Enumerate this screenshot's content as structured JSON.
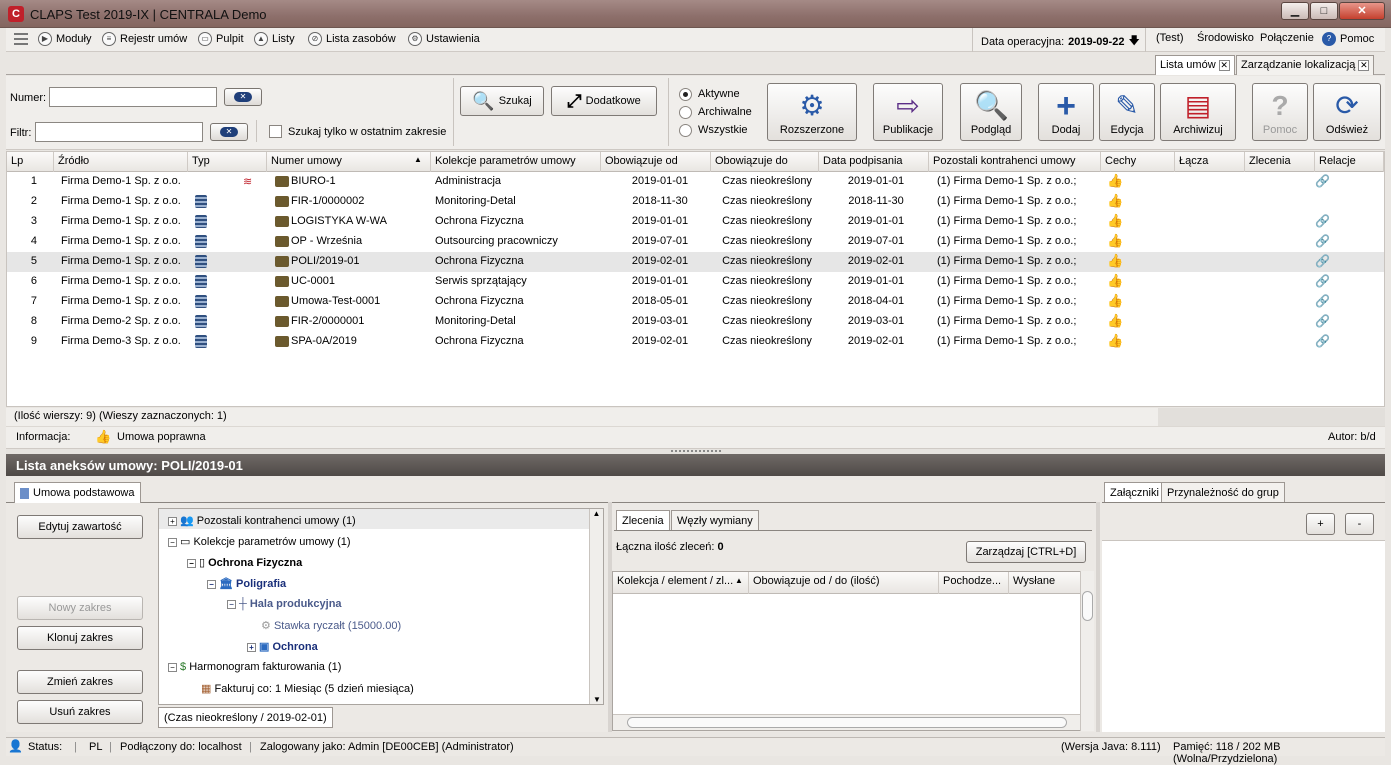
{
  "window": {
    "title": "CLAPS Test 2019-IX | CENTRALA Demo",
    "minimize": "▁",
    "maximize": "□",
    "close": "✕"
  },
  "menu": {
    "items": [
      {
        "label": "Moduły",
        "icon": "modules-icon"
      },
      {
        "label": "Rejestr umów",
        "icon": "register-icon"
      },
      {
        "label": "Pulpit",
        "icon": "desktop-icon"
      },
      {
        "label": "Listy",
        "icon": "lists-icon"
      },
      {
        "label": "Lista zasobów",
        "icon": "resources-icon"
      },
      {
        "label": "Ustawienia",
        "icon": "settings-icon"
      }
    ],
    "date_label": "Data operacyjna:",
    "date_value": "2019-09-22",
    "env_test": "(Test)",
    "env": "Środowisko",
    "connection": "Połączenie",
    "help": "Pomoc"
  },
  "tabs": [
    {
      "label": "Lista umów"
    },
    {
      "label": "Zarządzanie lokalizacją"
    }
  ],
  "toolbar": {
    "numer_label": "Numer:",
    "numer_value": "",
    "filtr_label": "Filtr:",
    "filtr_value": "",
    "only_last_label": "Szukaj tylko w ostatnim zakresie",
    "search_label": "Szukaj",
    "extra_label": "Dodatkowe",
    "radio": [
      "Aktywne",
      "Archiwalne",
      "Wszystkie"
    ],
    "radio_selected": "Aktywne",
    "buttons": {
      "extended": "Rozszerzone",
      "publication": "Publikacje",
      "preview": "Podgląd",
      "add": "Dodaj",
      "edit": "Edycja",
      "archive": "Archiwizuj",
      "help": "Pomoc",
      "refresh": "Odśwież"
    }
  },
  "table": {
    "columns": [
      "Lp",
      "Źródło",
      "Typ",
      "Numer umowy",
      "Kolekcje parametrów umowy",
      "Obowiązuje od",
      "Obowiązuje do",
      "Data podpisania",
      "Pozostali kontrahenci umowy",
      "Cechy",
      "Łącza",
      "Zlecenia",
      "Relacje"
    ],
    "rows": [
      {
        "lp": "1",
        "src": "Firma Demo-1 Sp. z o.o.",
        "num": "BIURO-1",
        "kol": "Administracja",
        "od": "2019-01-01",
        "do": "Czas nieokreślony",
        "podp": "2019-01-01",
        "kontr": "(1) Firma Demo-1 Sp. z o.o.;"
      },
      {
        "lp": "2",
        "src": "Firma Demo-1 Sp. z o.o.",
        "num": "FIR-1/0000002",
        "kol": "Monitoring-Detal",
        "od": "2018-11-30",
        "do": "Czas nieokreślony",
        "podp": "2018-11-30",
        "kontr": "(1) Firma Demo-1 Sp. z o.o.;"
      },
      {
        "lp": "3",
        "src": "Firma Demo-1 Sp. z o.o.",
        "num": "LOGISTYKA W-WA",
        "kol": "Ochrona Fizyczna",
        "od": "2019-01-01",
        "do": "Czas nieokreślony",
        "podp": "2019-01-01",
        "kontr": "(1) Firma Demo-1 Sp. z o.o.;"
      },
      {
        "lp": "4",
        "src": "Firma Demo-1 Sp. z o.o.",
        "num": "OP - Września",
        "kol": "Outsourcing pracowniczy",
        "od": "2019-07-01",
        "do": "Czas nieokreślony",
        "podp": "2019-07-01",
        "kontr": "(1) Firma Demo-1 Sp. z o.o.;"
      },
      {
        "lp": "5",
        "src": "Firma Demo-1 Sp. z o.o.",
        "num": "POLI/2019-01",
        "kol": "Ochrona Fizyczna",
        "od": "2019-02-01",
        "do": "Czas nieokreślony",
        "podp": "2019-02-01",
        "kontr": "(1) Firma Demo-1 Sp. z o.o.;"
      },
      {
        "lp": "6",
        "src": "Firma Demo-1 Sp. z o.o.",
        "num": "UC-0001",
        "kol": "Serwis sprzątający",
        "od": "2019-01-01",
        "do": "Czas nieokreślony",
        "podp": "2019-01-01",
        "kontr": "(1) Firma Demo-1 Sp. z o.o.;"
      },
      {
        "lp": "7",
        "src": "Firma Demo-1 Sp. z o.o.",
        "num": "Umowa-Test-0001",
        "kol": "Ochrona Fizyczna",
        "od": "2018-05-01",
        "do": "Czas nieokreślony",
        "podp": "2018-04-01",
        "kontr": "(1) Firma Demo-1 Sp. z o.o.;"
      },
      {
        "lp": "8",
        "src": "Firma Demo-2 Sp. z o.o.",
        "num": "FIR-2/0000001",
        "kol": "Monitoring-Detal",
        "od": "2019-03-01",
        "do": "Czas nieokreślony",
        "podp": "2019-03-01",
        "kontr": "(1) Firma Demo-1 Sp. z o.o.;"
      },
      {
        "lp": "9",
        "src": "Firma Demo-3 Sp. z o.o.",
        "num": "SPA-0A/2019",
        "kol": "Ochrona Fizyczna",
        "od": "2019-02-01",
        "do": "Czas nieokreślony",
        "podp": "2019-02-01",
        "kontr": "(1) Firma Demo-1 Sp. z o.o.;"
      }
    ],
    "summary": "(Ilość wierszy: 9)  (Wieszy zaznaczonych: 1)",
    "info_label": "Informacja:",
    "info_value": "Umowa poprawna",
    "author": "Autor: b/d"
  },
  "lower": {
    "title": "Lista aneksów umowy: POLI/2019-01",
    "tab": "Umowa podstawowa",
    "buttons": {
      "edit": "Edytuj zawartość",
      "new": "Nowy zakres",
      "clone": "Klonuj zakres",
      "change": "Zmień zakres",
      "delete": "Usuń zakres"
    },
    "tree": [
      "Pozostali kontrahenci umowy (1)",
      "Kolekcje parametrów umowy (1)",
      "Ochrona Fizyczna",
      "Poligrafia",
      "Hala produkcyjna",
      "Stawka ryczałt (15000.00)",
      "Ochrona",
      "Harmonogram fakturowania (1)",
      "Fakturuj co: 1 Miesiąc (5 dzień miesiąca)"
    ],
    "scope_tab": "(Czas nieokreślony / 2019-02-01)",
    "mid_tabs": [
      "Zlecenia",
      "Węzły wymiany"
    ],
    "orders_label": "Łączna ilość zleceń:",
    "orders_count": "0",
    "manage_btn": "Zarządzaj [CTRL+D]",
    "order_cols": [
      "Kolekcja / element / zl...",
      "Obowiązuje od / do (ilość)",
      "Pochodze...",
      "Wysłane"
    ],
    "right_tabs": [
      "Załączniki",
      "Przynależność do grup"
    ],
    "plus": "+",
    "minus": "-"
  },
  "status": {
    "status": "Status:",
    "lang": "PL",
    "connected": "Podłączony do: localhost",
    "logged": "Zalogowany jako: Admin [DE00CEB] (Administrator)",
    "java": "(Wersja Java: 8.111)",
    "memory": "Pamięć: 118 / 202 MB (Wolna/Przydzielona)"
  }
}
